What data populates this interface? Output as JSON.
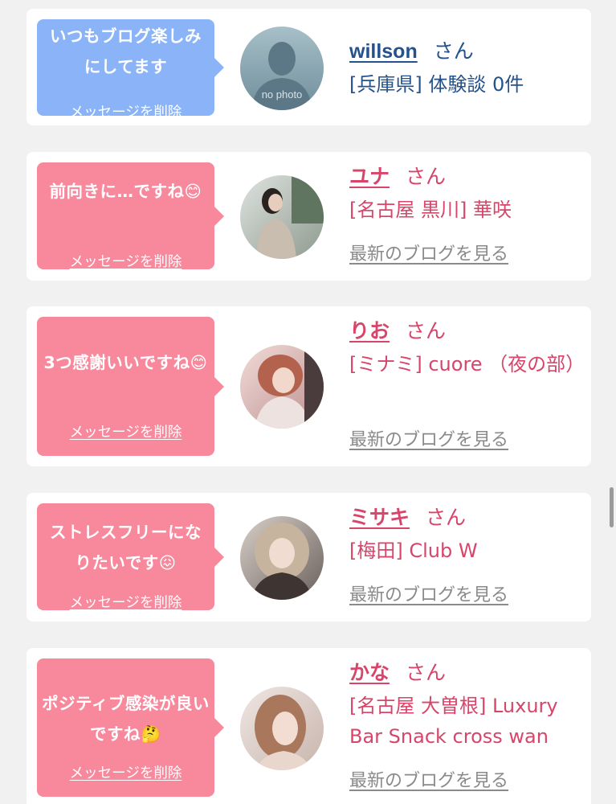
{
  "cards": [
    {
      "message": "いつもブログ楽しみにしてます",
      "delete_label": "メッセージを削除",
      "name": "willson",
      "honorific": "さん",
      "location": "[兵庫県] 体験談 0件",
      "avatar_label": "no photo",
      "bubble_color": "#8ab4f7",
      "name_color": "#24528d"
    },
    {
      "message": "前向きに…ですね😊",
      "delete_label": "メッセージを削除",
      "name": "ユナ",
      "honorific": "さん",
      "location": "[名古屋 黒川] 華咲",
      "blog_link": "最新のブログを見る",
      "bubble_color": "#f8899c",
      "name_color": "#d8456a"
    },
    {
      "message": "3つ感謝いいですね😊",
      "delete_label": "メッセージを削除",
      "name": "りお",
      "honorific": "さん",
      "location": "[ミナミ] cuore （夜の部）",
      "blog_link": "最新のブログを見る",
      "bubble_color": "#f8899c",
      "name_color": "#d8456a"
    },
    {
      "message": "ストレスフリーになりたいです😖",
      "delete_label": "メッセージを削除",
      "name": "ミサキ",
      "honorific": "さん",
      "location": "[梅田] Club W",
      "blog_link": "最新のブログを見る",
      "bubble_color": "#f8899c",
      "name_color": "#d8456a"
    },
    {
      "message": "ポジティブ感染が良いですね🤔",
      "delete_label": "メッセージを削除",
      "name": "かな",
      "honorific": "さん",
      "location": "[名古屋 大曽根] Luxury Bar Snack cross wan",
      "blog_link": "最新のブログを見る",
      "bubble_color": "#f8899c",
      "name_color": "#d8456a"
    }
  ]
}
